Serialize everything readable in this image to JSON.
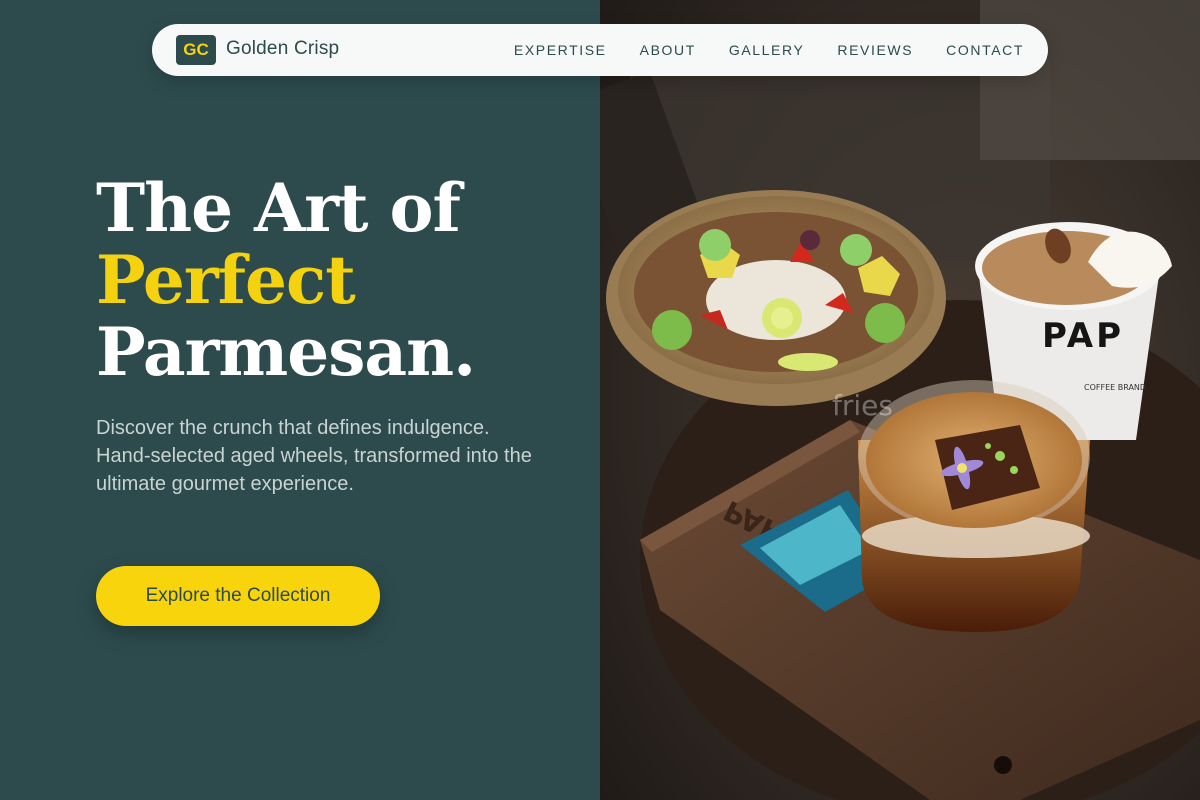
{
  "nav": {
    "logo_initials": "GC",
    "brand": "Golden Crisp",
    "links": [
      "EXPERTISE",
      "ABOUT",
      "GALLERY",
      "REVIEWS",
      "CONTACT"
    ]
  },
  "hero": {
    "headline_line1": "The Art of",
    "headline_line2": "Perfect",
    "headline_line3": "Parmesan.",
    "description": "Discover the crunch that defines indulgence. Hand-selected aged wheels, transformed into the ultimate gourmet experience.",
    "cta_label": "Explore the Collection"
  },
  "photo": {
    "cup_brand": "PAP",
    "cup_sub": "COFFEE BRAND",
    "tray_engraving": "PAPZZ",
    "watermark": "fries"
  },
  "colors": {
    "background": "#2d4b4d",
    "accent": "#f5d20f",
    "button": "#f8d40c",
    "nav_bg": "#f7f8f8"
  }
}
